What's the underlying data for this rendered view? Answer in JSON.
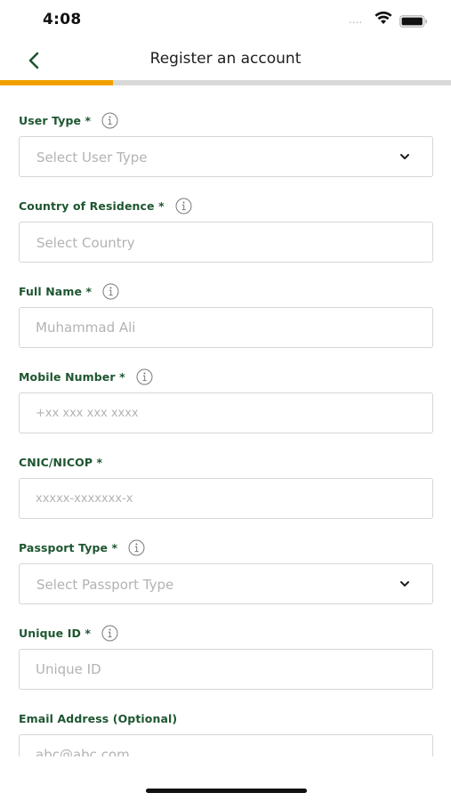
{
  "status_bar": {
    "time": "4:08",
    "signal_dots": "....",
    "wifi_icon": "wifi-icon",
    "battery_icon": "battery-icon"
  },
  "nav": {
    "title": "Register an account",
    "back_icon": "chevron-left-icon"
  },
  "progress": {
    "fraction": 0.25,
    "fill_color": "#f2a000",
    "track_color": "#d9d9d9"
  },
  "colors": {
    "label": "#1e5631",
    "placeholder": "#b3b3b3",
    "border": "#d6d6d6"
  },
  "form": {
    "user_type": {
      "label": "User Type *",
      "placeholder": "Select User Type"
    },
    "country": {
      "label": "Country of Residence *",
      "placeholder": "Select Country"
    },
    "full_name": {
      "label": "Full Name *",
      "placeholder": "Muhammad Ali"
    },
    "mobile": {
      "label": "Mobile Number *",
      "placeholder": "+xx xxx xxx xxxx"
    },
    "cnic": {
      "label": "CNIC/NICOP *",
      "placeholder": "xxxxx-xxxxxxx-x"
    },
    "passport_type": {
      "label": "Passport Type *",
      "placeholder": "Select Passport Type"
    },
    "unique_id": {
      "label": "Unique ID *",
      "placeholder": "Unique ID"
    },
    "email": {
      "label": "Email Address (Optional)",
      "placeholder": "abc@abc.com"
    }
  }
}
